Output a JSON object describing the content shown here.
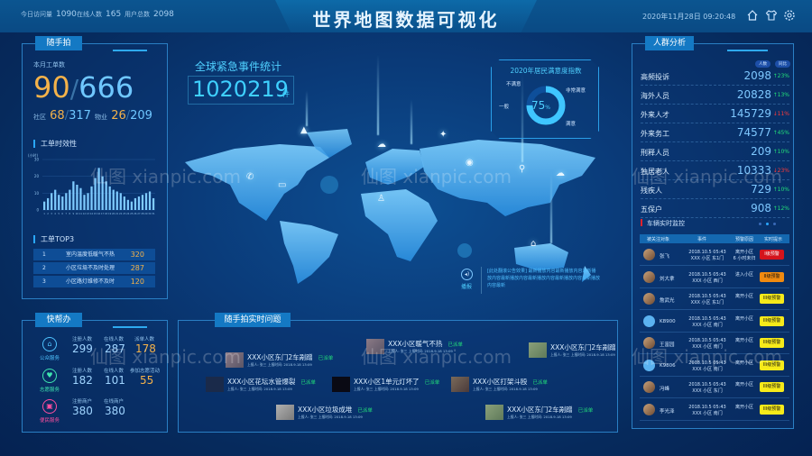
{
  "header": {
    "title": "世界地图数据可视化",
    "stats": [
      {
        "label": "今日访问量",
        "value": "1090"
      },
      {
        "label": "在线人数",
        "value": "165"
      },
      {
        "label": "用户总数",
        "value": "2098"
      }
    ],
    "datetime": "2020年11月28日  09:20:48",
    "icons": [
      "home-icon",
      "shirt-icon",
      "gear-icon"
    ]
  },
  "suishoupai": {
    "tab": "随手拍",
    "monthly_label": "本月工单数",
    "monthly_done": "90",
    "monthly_total": "666",
    "community_label": "社区",
    "community_done": "68",
    "community_total": "317",
    "property_label": "物业",
    "property_done": "26",
    "property_total": "209",
    "timeliness_title": "工单时效性",
    "top3_title": "工单TOP3",
    "top3": [
      {
        "rank": "1",
        "title": "室内温度低暖气不热",
        "value": "320"
      },
      {
        "rank": "2",
        "title": "小区垃圾不及时处理",
        "value": "287"
      },
      {
        "rank": "3",
        "title": "小区路灯维修不及时",
        "value": "120"
      }
    ]
  },
  "chart_data": {
    "type": "bar",
    "title": "工单时效性",
    "ylabel": "(小时)",
    "ylim": [
      0,
      30
    ],
    "yticks": [
      0,
      10,
      20,
      30
    ],
    "categories": [
      "1",
      "2",
      "3",
      "4",
      "5",
      "6",
      "7",
      "8",
      "9",
      "10",
      "11",
      "12",
      "13",
      "14",
      "15",
      "16",
      "17",
      "18",
      "19",
      "20",
      "21",
      "22",
      "23",
      "24",
      "25",
      "26",
      "27",
      "28",
      "29",
      "30",
      "31"
    ],
    "values": [
      5,
      7,
      10,
      12,
      9,
      8,
      10,
      12,
      17,
      15,
      13,
      9,
      10,
      14,
      19,
      25,
      20,
      17,
      14,
      12,
      11,
      10,
      8,
      6,
      5,
      7,
      8,
      9,
      10,
      11,
      7
    ],
    "grid": true
  },
  "kuaibangban": {
    "tab": "快帮办",
    "services": [
      {
        "name": "公众服务",
        "icon": "home-service-icon",
        "color": "#4fc3ff",
        "stats": [
          {
            "k": "注册人数",
            "v": "299"
          },
          {
            "k": "在线人数",
            "v": "287"
          },
          {
            "k": "派单人数",
            "v": "178"
          }
        ]
      },
      {
        "name": "志愿服务",
        "icon": "volunteer-icon",
        "color": "#3fe6b0",
        "stats": [
          {
            "k": "注册人数",
            "v": "182"
          },
          {
            "k": "在线人数",
            "v": "101"
          },
          {
            "k": "参加志愿活动",
            "v": "55"
          }
        ]
      },
      {
        "name": "便民服务",
        "icon": "shop-icon",
        "color": "#ff4fa0",
        "stats": [
          {
            "k": "注册商户",
            "v": "380"
          },
          {
            "k": "在线商户",
            "v": "380"
          }
        ]
      }
    ]
  },
  "emergency": {
    "title": "全球紧急事件统计",
    "value": "1020219",
    "unit": "件"
  },
  "satisfaction": {
    "title": "2020年居民满意度指数",
    "percent": 75,
    "percent_label": "75",
    "percent_unit": "%",
    "labels": [
      "不满意",
      "非常满意",
      "一般",
      "满意"
    ]
  },
  "broadcast": {
    "label": "播报",
    "text": "[此处翻滚公告效果] 最新播放内容最新播放内容最新播放内容最新播放内容最新播放内容最新播放内容最新播放内容最新"
  },
  "issues": {
    "tab": "随手拍实时问题",
    "items": [
      {
        "title": "XXX小区东门2车剐蹭",
        "status": "已派单",
        "meta": "上报人: 张三    上报时间: 2018.9.18 13:09"
      },
      {
        "title": "XXX小区暖气不热",
        "status": "已派单",
        "meta": "上报人: 张三    上报时间: 2018.9.18 13:09"
      },
      {
        "title": "XXX小区东门2车剐蹭",
        "status": "已派单",
        "meta": "上报人: 张三    上报时间: 2018.9.18 13:09"
      },
      {
        "title": "XXX小区花坛水管爆裂",
        "status": "已派单",
        "meta": "上报人: 张三    上报时间: 2018.9.18 13:09"
      },
      {
        "title": "XXX小区1单元灯坏了",
        "status": "已派单",
        "meta": "上报人: 张三    上报时间: 2018.9.18 13:09"
      },
      {
        "title": "XXX小区打架斗殴",
        "status": "已派单",
        "meta": "上报人: 张三    上报时间: 2018.9.18 13:09"
      },
      {
        "title": "XXX小区垃圾成堆",
        "status": "已派单",
        "meta": "上报人: 张三    上报时间: 2018.9.18 13:09"
      },
      {
        "title": "XXX小区东门2车剐蹭",
        "status": "已派单",
        "meta": "上报人: 张三    上报时间: 2018.9.18 13:09"
      }
    ]
  },
  "crowd": {
    "tab": "人群分析",
    "col_people": "人数",
    "col_yoy": "同比",
    "rows": [
      {
        "name": "高频投诉",
        "value": "2098",
        "change": "23%",
        "dir": "up"
      },
      {
        "name": "海外人员",
        "value": "20828",
        "change": "13%",
        "dir": "up"
      },
      {
        "name": "外来人才",
        "value": "145729",
        "change": "11%",
        "dir": "down"
      },
      {
        "name": "外来务工",
        "value": "74577",
        "change": "45%",
        "dir": "up"
      },
      {
        "name": "刑释人员",
        "value": "209",
        "change": "10%",
        "dir": "up"
      },
      {
        "name": "独居老人",
        "value": "10333",
        "change": "23%",
        "dir": "down"
      },
      {
        "name": "残疾人",
        "value": "729",
        "change": "10%",
        "dir": "up"
      },
      {
        "name": "五保户",
        "value": "908",
        "change": "12%",
        "dir": "up"
      }
    ],
    "up_color": "#22e07a",
    "down_color": "#ff3b3b"
  },
  "vehicles": {
    "title": "车辆实时监控",
    "headers": [
      "被关注对象",
      "事件",
      "预警原因",
      "实时提示"
    ],
    "rows": [
      {
        "name": "张飞",
        "type": "person",
        "event1": "2018.10.5 05:43",
        "event2": "XXX 小区 东1门",
        "reason1": "离开小区",
        "reason2": "6 小时未归",
        "warn": "I级预警",
        "level": 1
      },
      {
        "name": "刘大拿",
        "type": "person",
        "event1": "2018.10.5 05:43",
        "event2": "XXX 小区 西门",
        "reason1": "进入小区",
        "reason2": "",
        "warn": "II级预警",
        "level": 2
      },
      {
        "name": "詹武光",
        "type": "person",
        "event1": "2018.10.5 05:43",
        "event2": "XXX 小区 东1门",
        "reason1": "离开小区",
        "reason2": "",
        "warn": "III级预警",
        "level": 3
      },
      {
        "name": "K8900",
        "type": "car",
        "event1": "2018.10.5 05:43",
        "event2": "XXX 小区 南门",
        "reason1": "离开小区",
        "reason2": "",
        "warn": "III级预警",
        "level": 3
      },
      {
        "name": "王富园",
        "type": "person",
        "event1": "2018.10.5 05:43",
        "event2": "XXX 小区 南门",
        "reason1": "离开小区",
        "reason2": "",
        "warn": "III级预警",
        "level": 3
      },
      {
        "name": "K9806",
        "type": "car",
        "event1": "2018.10.5 05:43",
        "event2": "XXX 小区 南门",
        "reason1": "离开小区",
        "reason2": "",
        "warn": "III级预警",
        "level": 3
      },
      {
        "name": "冯峰",
        "type": "person",
        "event1": "2018.10.5 05:43",
        "event2": "XXX 小区 东门",
        "reason1": "离开小区",
        "reason2": "",
        "warn": "III级预警",
        "level": 3
      },
      {
        "name": "李光泽",
        "type": "person",
        "event1": "2018.10.5 05:43",
        "event2": "XXX 小区 南门",
        "reason1": "离开小区",
        "reason2": "",
        "warn": "III级预警",
        "level": 3
      }
    ],
    "warn_colors": {
      "1": "#d4141c",
      "2": "#f08a10",
      "3": "#f6ea1a"
    }
  },
  "watermark": "仙图 xianpic.com"
}
